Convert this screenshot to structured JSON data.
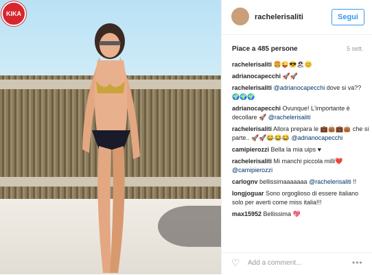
{
  "badge": {
    "label": "KIKA"
  },
  "post": {
    "username": "rachelerisaliti",
    "follow_label": "Segui",
    "likes": "Piace a 485 persone",
    "time": "5 sett."
  },
  "comments": [
    {
      "user": "rachelerisaliti",
      "text": " 🍔😜😎🏖😊"
    },
    {
      "user": "adrianocapecchi",
      "text": " 🚀🚀"
    },
    {
      "user": "rachelerisaliti",
      "mention": "@adrianocapecchi",
      "text": " dove si va?? 🌍🌍🌍"
    },
    {
      "user": "adrianocapecchi",
      "text": " Ovunque! L'importante è decollare 🚀 ",
      "mention2": "@rachelerisaliti"
    },
    {
      "user": "rachelerisaliti",
      "text": " Allora prepara le 💼👜💼👜 che si parte.. 🚀🚀😂😂😂 ",
      "mention2": "@adrianocapecchi"
    },
    {
      "user": "camipierozzi",
      "text": " Bella la mia uips ♥"
    },
    {
      "user": "rachelerisaliti",
      "text": " Mi manchi piccola milli❤️ ",
      "mention2": "@camipierozzi"
    },
    {
      "user": "carlognv",
      "text": " bellissimaaaaaaa ",
      "mention2": "@rachelerisaliti",
      "tail": " !!"
    },
    {
      "user": "longjoguar",
      "text": " Sono orgoglioso di essere italiano solo per averti come miss italia!!!"
    },
    {
      "user": "max15952",
      "text": " Bellissima 💖"
    }
  ],
  "footer": {
    "add_comment": "Add a comment...",
    "more": "•••"
  },
  "colors": {
    "accent": "#3897f0",
    "text": "#262626",
    "muted": "#999999"
  }
}
